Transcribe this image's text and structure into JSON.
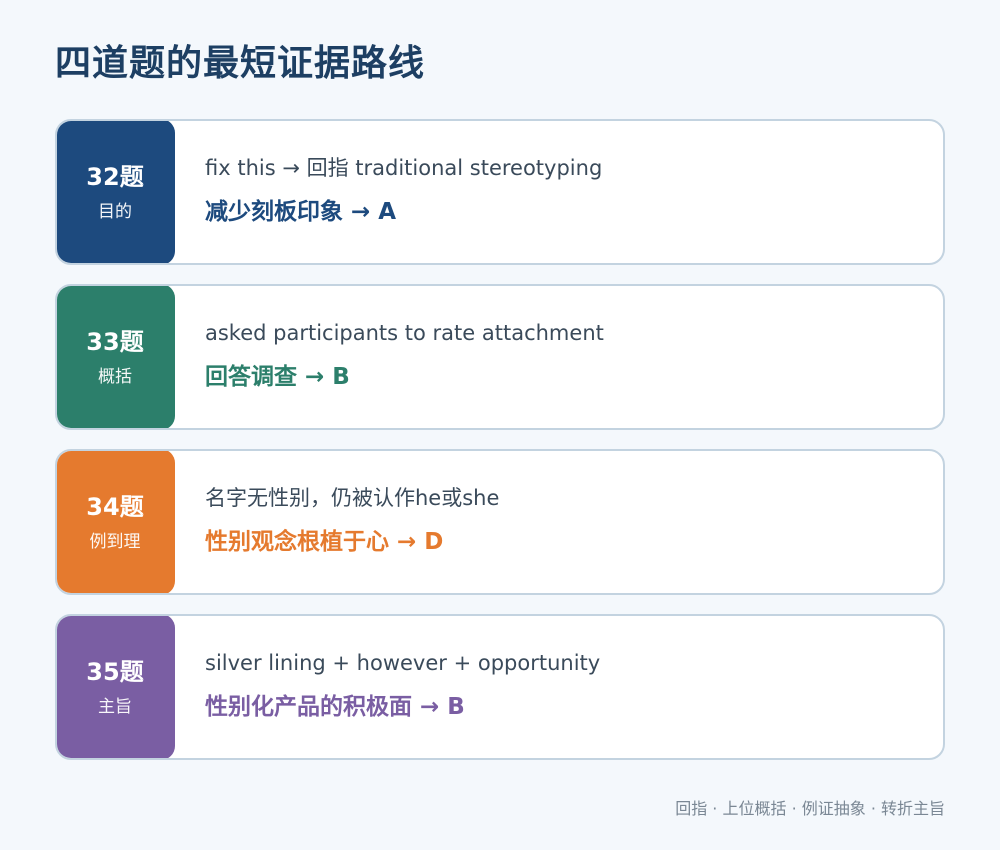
{
  "page": {
    "title": "四道题的最短证据路线",
    "footer": "回指 · 上位概括 · 例证抽象 · 转折主旨"
  },
  "cards": [
    {
      "number": "32题",
      "type": "目的",
      "evidence": "fix this → 回指 traditional stereotyping",
      "answer": "减少刻板印象 → A",
      "color": "#1d4a7e"
    },
    {
      "number": "33题",
      "type": "概括",
      "evidence": "asked participants to rate attachment",
      "answer": "回答调查 → B",
      "color": "#2c7f6b"
    },
    {
      "number": "34题",
      "type": "例到理",
      "evidence": "名字无性别，仍被认作he或she",
      "answer": "性别观念根植于心 → D",
      "color": "#e57a2e"
    },
    {
      "number": "35题",
      "type": "主旨",
      "evidence": "silver lining + however + opportunity",
      "answer": "性别化产品的积极面 → B",
      "color": "#7a5ea3"
    }
  ]
}
